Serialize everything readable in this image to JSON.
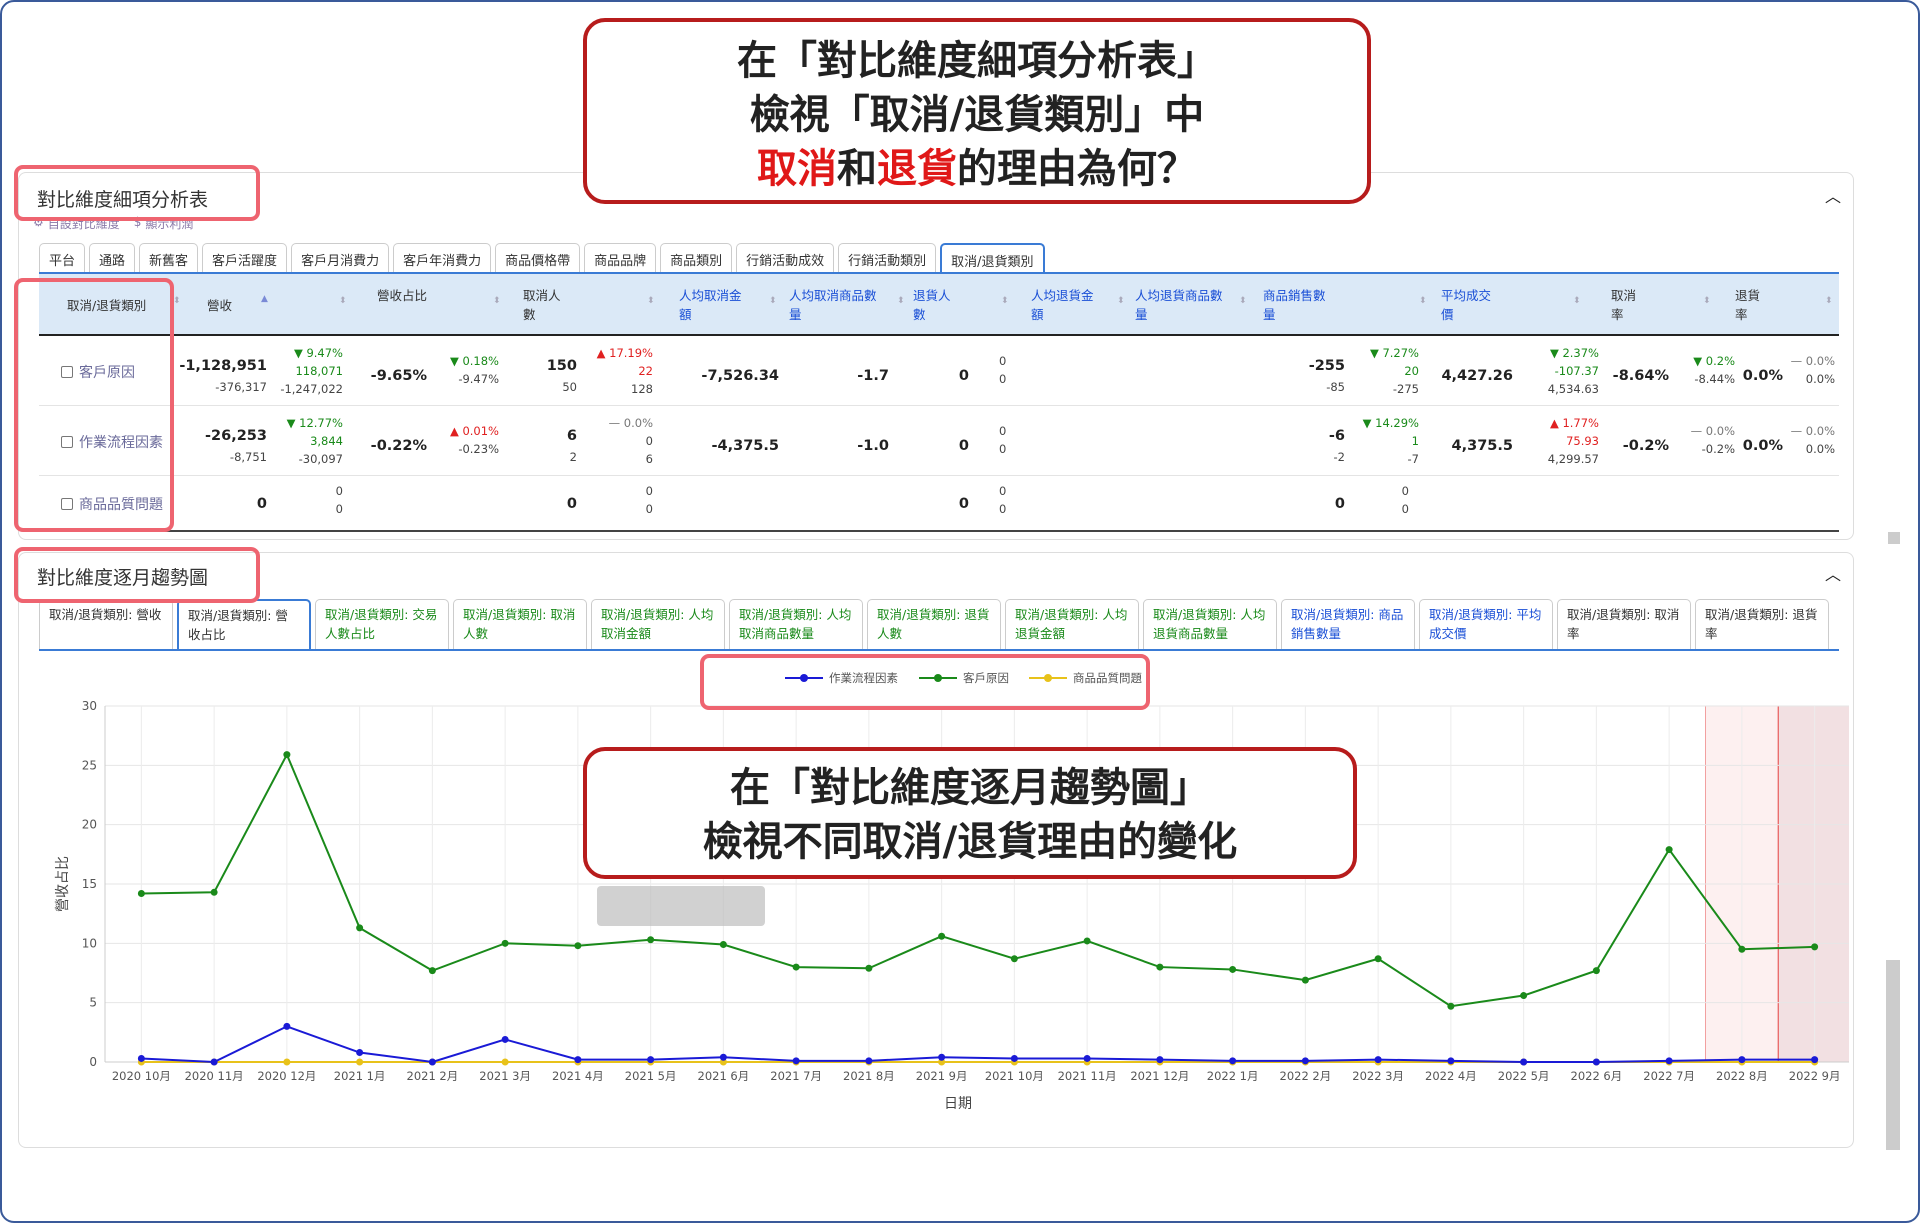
{
  "panel1": {
    "title": "對比維度細項分析表",
    "links": [
      "自設對比維度",
      "顯示利潤"
    ],
    "tabs": [
      "平台",
      "通路",
      "新舊客",
      "客戶活躍度",
      "客戶月消費力",
      "客戶年消費力",
      "商品價格帶",
      "商品品牌",
      "商品類別",
      "行銷活動成效",
      "行銷活動類別",
      "取消/退貨類別"
    ],
    "active_tab": "取消/退貨類別",
    "headers": [
      "取消/退貨類別",
      "營收",
      "營收占比",
      "取消人數",
      "人均取消金額",
      "人均取消商品數量",
      "退貨人數",
      "人均退貨金額",
      "人均退貨商品數量",
      "商品銷售數量",
      "平均成交價",
      "取消率",
      "退貨率"
    ],
    "rows": [
      {
        "label": "客戶原因",
        "revenue": "-1,128,951",
        "revenue_prev": "-376,317",
        "revenue_pct": "▼ 9.47%",
        "revenue_cmp": "118,071",
        "revenue_cmp2": "-1,247,022",
        "share": "-9.65%",
        "share_pct": "▼ 0.18%",
        "share_cmp": "-9.47%",
        "cancel": "150",
        "cancel_prev": "50",
        "cancel_pct": "▲ 17.19%",
        "cancel_cmp": "22",
        "cancel_cmp2": "128",
        "avg_cancel_amt": "-7,526.34",
        "avg_cancel_qty": "-1.7",
        "return": "0",
        "return_cmp": "0",
        "return_cmp2": "0",
        "qty": "-255",
        "qty_prev": "-85",
        "qty_pct": "▼ 7.27%",
        "qty_cmp": "20",
        "qty_cmp2": "-275",
        "price": "4,427.26",
        "price_pct": "▼ 2.37%",
        "price_cmp": "-107.37",
        "price_cmp2": "4,534.63",
        "cancel_rate": "-8.64%",
        "cr_pct": "▼ 0.2%",
        "cr_cmp": "-8.44%",
        "return_rate": "0.0%",
        "rr_pct": "— 0.0%",
        "rr_cmp": "0.0%"
      },
      {
        "label": "作業流程因素",
        "revenue": "-26,253",
        "revenue_prev": "-8,751",
        "revenue_pct": "▼ 12.77%",
        "revenue_cmp": "3,844",
        "revenue_cmp2": "-30,097",
        "share": "-0.22%",
        "share_pct": "▲ 0.01%",
        "share_cmp": "-0.23%",
        "cancel": "6",
        "cancel_prev": "2",
        "cancel_pct": "— 0.0%",
        "cancel_cmp": "0",
        "cancel_cmp2": "6",
        "avg_cancel_amt": "-4,375.5",
        "avg_cancel_qty": "-1.0",
        "return": "0",
        "return_cmp": "0",
        "return_cmp2": "0",
        "qty": "-6",
        "qty_prev": "-2",
        "qty_pct": "▼ 14.29%",
        "qty_cmp": "1",
        "qty_cmp2": "-7",
        "price": "4,375.5",
        "price_pct": "▲ 1.77%",
        "price_cmp": "75.93",
        "price_cmp2": "4,299.57",
        "cancel_rate": "-0.2%",
        "cr_pct": "— 0.0%",
        "cr_cmp": "-0.2%",
        "return_rate": "0.0%",
        "rr_pct": "— 0.0%",
        "rr_cmp": "0.0%"
      },
      {
        "label": "商品品質問題",
        "revenue": "0",
        "revenue_cmp": "0",
        "revenue_cmp2": "0",
        "cancel": "0",
        "cancel_cmp": "0",
        "cancel_cmp2": "0",
        "return": "0",
        "return_cmp": "0",
        "return_cmp2": "0",
        "qty": "0",
        "qty_cmp": "0",
        "qty_cmp2": "0"
      }
    ]
  },
  "panel2": {
    "title": "對比維度逐月趨勢圖",
    "tabs": [
      "取消/退貨類別: 營收",
      "取消/退貨類別: 營收占比",
      "取消/退貨類別: 交易人數占比",
      "取消/退貨類別: 取消人數",
      "取消/退貨類別: 人均取消金額",
      "取消/退貨類別: 人均取消商品數量",
      "取消/退貨類別: 退貨人數",
      "取消/退貨類別: 人均退貨金額",
      "取消/退貨類別: 人均退貨商品數量",
      "取消/退貨類別: 商品銷售數量",
      "取消/退貨類別: 平均成交價",
      "取消/退貨類別: 取消率",
      "取消/退貨類別: 退貨率"
    ],
    "active_tab": "取消/退貨類別: 營收占比"
  },
  "chart_data": {
    "type": "line",
    "xlabel": "日期",
    "ylabel": "營收占比",
    "ylim": [
      0,
      30
    ],
    "yticks": [
      0,
      5,
      10,
      15,
      20,
      25,
      30
    ],
    "categories": [
      "2020 10月",
      "2020 11月",
      "2020 12月",
      "2021 1月",
      "2021 2月",
      "2021 3月",
      "2021 4月",
      "2021 5月",
      "2021 6月",
      "2021 7月",
      "2021 8月",
      "2021 9月",
      "2021 10月",
      "2021 11月",
      "2021 12月",
      "2022 1月",
      "2022 2月",
      "2022 3月",
      "2022 4月",
      "2022 5月",
      "2022 6月",
      "2022 7月",
      "2022 8月",
      "2022 9月"
    ],
    "series": [
      {
        "name": "作業流程因素",
        "color": "#1a1ad6",
        "values": [
          0.3,
          0.0,
          3.0,
          0.8,
          0.0,
          1.9,
          0.2,
          0.2,
          0.4,
          0.1,
          0.1,
          0.4,
          0.3,
          0.3,
          0.2,
          0.1,
          0.1,
          0.2,
          0.1,
          0.0,
          0.0,
          0.1,
          0.2,
          0.2
        ]
      },
      {
        "name": "客戶原因",
        "color": "#1a8a1a",
        "values": [
          14.2,
          14.3,
          25.9,
          11.3,
          7.7,
          10.0,
          9.8,
          10.3,
          9.9,
          8.0,
          7.9,
          10.6,
          8.7,
          10.2,
          8.0,
          7.8,
          6.9,
          8.7,
          4.7,
          5.6,
          7.7,
          17.9,
          9.5,
          9.7
        ]
      },
      {
        "name": "商品品質問題",
        "color": "#e8c21a",
        "values": [
          0,
          0,
          0,
          0,
          0,
          0,
          0,
          0,
          0,
          0,
          0,
          0,
          0,
          0,
          0,
          0,
          0,
          0,
          0,
          0,
          0,
          0,
          0,
          0
        ]
      }
    ],
    "legend": "top-center",
    "grid": true
  },
  "callouts": {
    "top_line1": "在「對比維度細項分析表」",
    "top_line2": "檢視「取消/退貨類別」中",
    "top_red1": "取消",
    "top_mid": "和",
    "top_red2": "退貨",
    "top_end": "的理由為何？",
    "mid_line1": "在「對比維度逐月趨勢圖」",
    "mid_line2": "檢視不同取消/退貨理由的變化"
  }
}
